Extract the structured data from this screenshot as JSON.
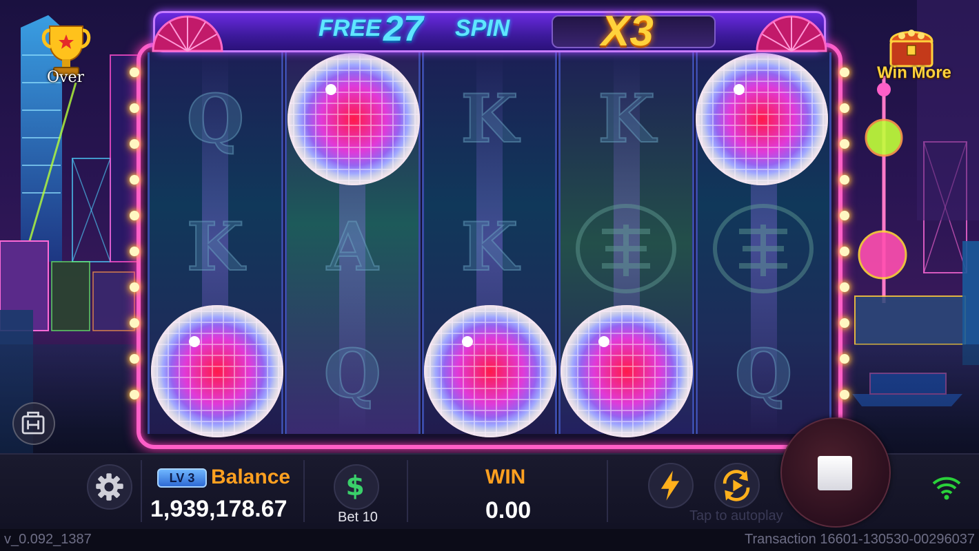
{
  "header": {
    "free_prefix": "FREE",
    "free_count": "27",
    "free_suffix": "SPIN",
    "multiplier": "X3"
  },
  "left_widgets": {
    "trophy_label": "Over"
  },
  "right_widgets": {
    "chest_label": "Win More"
  },
  "reels": [
    {
      "symbols": [
        "Q",
        "K",
        "disco-ball"
      ],
      "ball_rows": [
        2
      ]
    },
    {
      "symbols": [
        "disco-ball",
        "A",
        "Q"
      ],
      "ball_rows": [
        0
      ]
    },
    {
      "symbols": [
        "K",
        "K",
        "disco-ball"
      ],
      "ball_rows": [
        2
      ]
    },
    {
      "symbols": [
        "K",
        "seal",
        "disco-ball"
      ],
      "ball_rows": [
        2
      ]
    },
    {
      "symbols": [
        "disco-ball",
        "seal",
        "Q"
      ],
      "ball_rows": [
        0
      ]
    }
  ],
  "bottom_bar": {
    "level": "LV 3",
    "balance_label": "Balance",
    "balance_value": "1,939,178.67",
    "bet_label": "Bet 10",
    "win_label": "WIN",
    "win_value": "0.00",
    "autoplay_hint": "Tap to autoplay"
  },
  "footer": {
    "version": "v_0.092_1387",
    "transaction": "Transaction 16601-130530-00296037"
  },
  "colors": {
    "accent_orange": "#ffa020",
    "neon_pink": "#ff5fc8",
    "cyan_text": "#5fe6ff",
    "gold": "#ffd23c",
    "wifi_green": "#2ad13a"
  },
  "icons": {
    "settings": "gear-icon",
    "bet": "dollar-icon",
    "turbo": "lightning-icon",
    "autoplay": "autoplay-icon",
    "stop": "stop-icon",
    "network": "wifi-icon",
    "bag": "bag-icon",
    "trophy": "trophy-icon",
    "chest": "treasure-chest-icon"
  }
}
